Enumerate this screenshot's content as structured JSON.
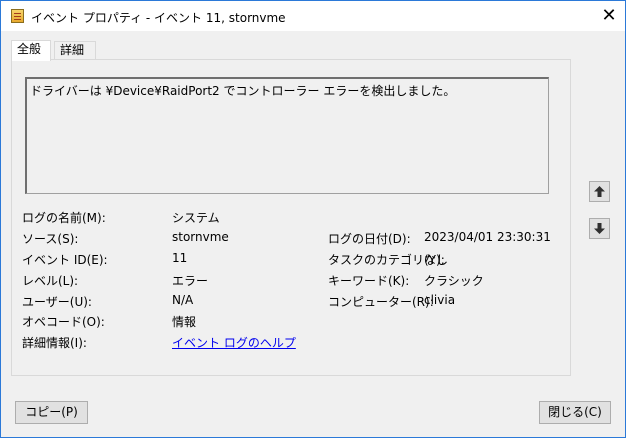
{
  "window": {
    "title": "イベント プロパティ - イベント 11, stornvme",
    "close_glyph": "✕"
  },
  "tabs": [
    {
      "label": "全般",
      "active": true
    },
    {
      "label": "詳細",
      "active": false
    }
  ],
  "description": "ドライバーは ¥Device¥RaidPort2 でコントローラー エラーを検出しました。",
  "fields": {
    "log_name": {
      "label": "ログの名前(M):",
      "value": "システム"
    },
    "source": {
      "label": "ソース(S):",
      "value": "stornvme"
    },
    "event_id": {
      "label": "イベント ID(E):",
      "value": "11"
    },
    "level": {
      "label": "レベル(L):",
      "value": "エラー"
    },
    "user": {
      "label": "ユーザー(U):",
      "value": "N/A"
    },
    "opcode": {
      "label": "オペコード(O):",
      "value": "情報"
    },
    "more_info": {
      "label": "詳細情報(I):",
      "value": "イベント ログのヘルプ"
    },
    "logged": {
      "label": "ログの日付(D):",
      "value": "2023/04/01 23:30:31"
    },
    "task_category": {
      "label": "タスクのカテゴリ(Y):",
      "value": "なし"
    },
    "keywords": {
      "label": "キーワード(K):",
      "value": "クラシック"
    },
    "computer": {
      "label": "コンピューター(R):",
      "value": "clivia"
    }
  },
  "buttons": {
    "copy": "コピー(P)",
    "close": "閉じる(C)"
  },
  "icons": {
    "up": "arrow-up-icon",
    "down": "arrow-down-icon",
    "app": "event-viewer-icon"
  }
}
